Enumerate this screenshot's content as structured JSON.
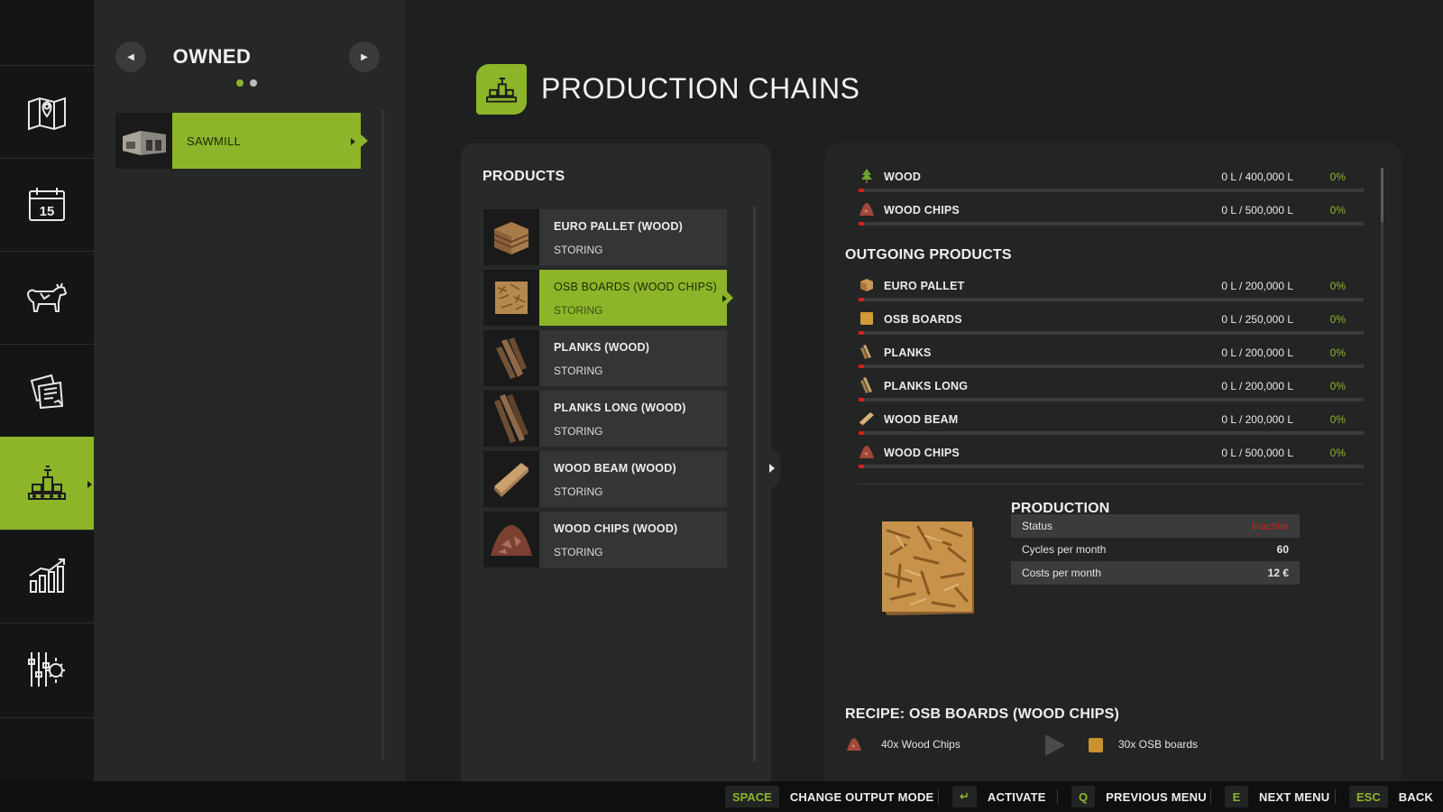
{
  "colors": {
    "accent": "#8cb52a",
    "status_inactive": "#d0201d",
    "bar_fill_low": "#d0201d"
  },
  "nav": {
    "items": [
      {
        "name": "map",
        "icon": "map-pin-icon"
      },
      {
        "name": "calendar",
        "icon": "calendar-icon",
        "label": "15"
      },
      {
        "name": "animals",
        "icon": "cow-icon"
      },
      {
        "name": "contracts",
        "icon": "documents-icon"
      },
      {
        "name": "production",
        "icon": "factory-icon",
        "active": true
      },
      {
        "name": "statistics",
        "icon": "bar-chart-icon"
      },
      {
        "name": "settings",
        "icon": "sliders-gear-icon"
      }
    ]
  },
  "owned": {
    "title": "OWNED",
    "page_count": 2,
    "current_page": 1,
    "items": [
      {
        "label": "SAWMILL",
        "selected": true
      }
    ]
  },
  "header": {
    "title": "PRODUCTION CHAINS",
    "icon": "factory-icon"
  },
  "products": {
    "heading": "PRODUCTS",
    "items": [
      {
        "name": "EURO PALLET (WOOD)",
        "state": "STORING"
      },
      {
        "name": "OSB BOARDS (WOOD CHIPS)",
        "state": "STORING",
        "selected": true
      },
      {
        "name": "PLANKS (WOOD)",
        "state": "STORING"
      },
      {
        "name": "PLANKS LONG (WOOD)",
        "state": "STORING"
      },
      {
        "name": "WOOD BEAM (WOOD)",
        "state": "STORING"
      },
      {
        "name": "WOOD CHIPS (WOOD)",
        "state": "STORING"
      }
    ]
  },
  "incoming": [
    {
      "name": "WOOD",
      "icon": "tree-icon",
      "amount": "0 L / 400,000 L",
      "percent": "0%",
      "fill": 0.0
    },
    {
      "name": "WOOD CHIPS",
      "icon": "wood-chips-icon",
      "amount": "0 L / 500,000 L",
      "percent": "0%",
      "fill": 0.0
    }
  ],
  "outgoing": {
    "heading": "OUTGOING PRODUCTS",
    "items": [
      {
        "name": "EURO PALLET",
        "icon": "pallet-icon",
        "amount": "0 L / 200,000 L",
        "percent": "0%",
        "fill": 0.0
      },
      {
        "name": "OSB BOARDS",
        "icon": "osb-board-icon",
        "amount": "0 L / 250,000 L",
        "percent": "0%",
        "fill": 0.0
      },
      {
        "name": "PLANKS",
        "icon": "planks-icon",
        "amount": "0 L / 200,000 L",
        "percent": "0%",
        "fill": 0.0
      },
      {
        "name": "PLANKS LONG",
        "icon": "planks-long-icon",
        "amount": "0 L / 200,000 L",
        "percent": "0%",
        "fill": 0.0
      },
      {
        "name": "WOOD BEAM",
        "icon": "wood-beam-icon",
        "amount": "0 L / 200,000 L",
        "percent": "0%",
        "fill": 0.0
      },
      {
        "name": "WOOD CHIPS",
        "icon": "wood-chips-icon",
        "amount": "0 L / 500,000 L",
        "percent": "0%",
        "fill": 0.0
      }
    ]
  },
  "production": {
    "heading": "PRODUCTION",
    "stats": [
      {
        "label": "Status",
        "value": "Inactive"
      },
      {
        "label": "Cycles per month",
        "value": "60"
      },
      {
        "label": "Costs per month",
        "value": "12 €"
      }
    ]
  },
  "recipe": {
    "heading": "RECIPE: OSB BOARDS (WOOD CHIPS)",
    "input": "40x Wood Chips",
    "output": "30x OSB boards"
  },
  "footer": {
    "hints": [
      {
        "key": "SPACE",
        "label": "CHANGE OUTPUT MODE"
      },
      {
        "key": "↵",
        "label": "ACTIVATE"
      },
      {
        "key": "Q",
        "label": "PREVIOUS MENU"
      },
      {
        "key": "E",
        "label": "NEXT MENU"
      },
      {
        "key": "ESC",
        "label": "BACK"
      }
    ]
  }
}
